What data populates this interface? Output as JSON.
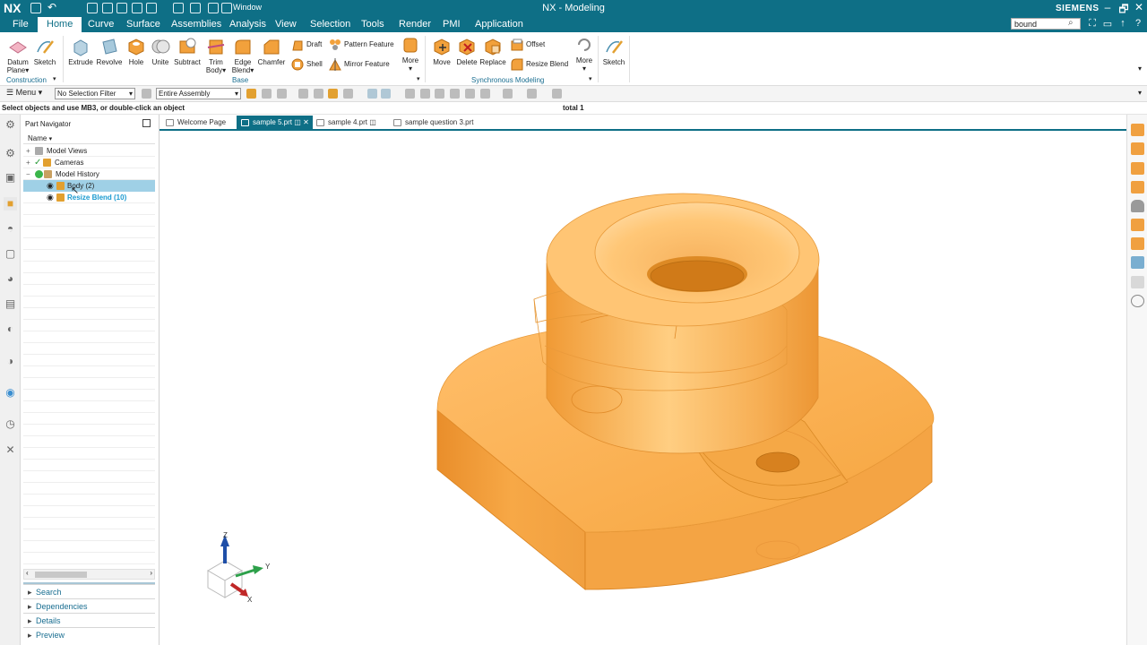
{
  "titlebar": {
    "app_logo": "NX",
    "title": "NX - Modeling",
    "window_menu": "Window",
    "brand": "SIEMENS",
    "controls": {
      "restore": "🗗",
      "minimize": "–",
      "maximize": "▢",
      "close": "✕"
    }
  },
  "menubar": {
    "tabs": [
      "File",
      "Home",
      "Curve",
      "Surface",
      "Assemblies",
      "Analysis",
      "View",
      "Selection",
      "Tools",
      "Render",
      "PMI",
      "Application"
    ],
    "active_tab": "Home",
    "search_value": "bound"
  },
  "ribbon": {
    "datum_plane": "Datum Plane",
    "sketch": "Sketch",
    "construction_group": "Construction",
    "extrude": "Extrude",
    "revolve": "Revolve",
    "hole": "Hole",
    "unite": "Unite",
    "subtract": "Subtract",
    "trim_body": "Trim Body",
    "edge_blend": "Edge Blend",
    "chamfer": "Chamfer",
    "draft": "Draft",
    "shell": "Shell",
    "pattern_feature": "Pattern Feature",
    "mirror_feature": "Mirror Feature",
    "more1": "More",
    "base_group": "Base",
    "move": "Move",
    "delete": "Delete",
    "replace": "Replace",
    "offset": "Offset",
    "resize_blend": "Resize Blend",
    "more2": "More",
    "sync_group": "Synchronous Modeling",
    "sketch2": "Sketch"
  },
  "toolbar": {
    "menu_label": "Menu",
    "selection_filter": "No Selection Filter",
    "scope": "Entire Assembly"
  },
  "status": {
    "prompt": "Select objects and use MB3, or double-click an object",
    "total": "total 1"
  },
  "navigator": {
    "title": "Part Navigator",
    "column_name": "Name",
    "tree": [
      {
        "label": "Model Views",
        "expander": "+"
      },
      {
        "label": "Cameras",
        "expander": "+"
      },
      {
        "label": "Model History",
        "expander": "−"
      },
      {
        "label": "Body (2)",
        "expander": ""
      },
      {
        "label": "Resize Blend (10)",
        "expander": ""
      }
    ],
    "sections": [
      "Search",
      "Dependencies",
      "Details",
      "Preview"
    ]
  },
  "doc_tabs": [
    "Welcome Page",
    "sample 5.prt",
    "sample 4.prt",
    "sample question 3.prt"
  ],
  "active_doc_tab": "sample 5.prt",
  "triad": {
    "x": "X",
    "y": "Y",
    "z": "Z"
  },
  "colors": {
    "title_bg": "#0e6f86",
    "part_orange": "#f4a53f",
    "part_light": "#ffc777",
    "part_dark": "#e0891f",
    "selected_row": "#9fd0e6",
    "link_blue": "#1a6e91"
  },
  "icons": {
    "search": "search-icon",
    "help": "help-icon",
    "eye": "eye-icon",
    "gear": "gear-icon"
  }
}
